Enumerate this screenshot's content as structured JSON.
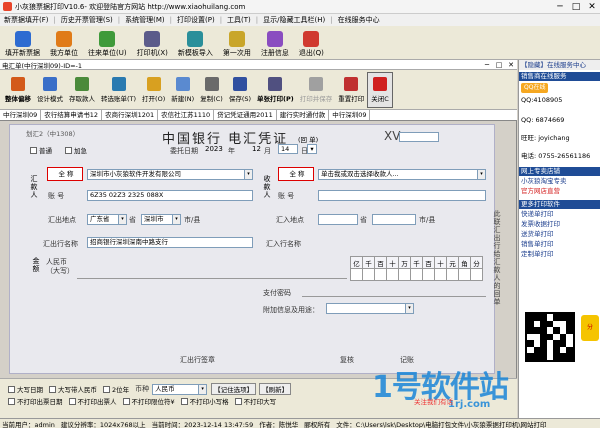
{
  "window": {
    "title": "小灰狼票据打印V10.6- 欢迎登陆官方网站 http://www.xiaohuilang.com"
  },
  "menu": [
    "新票据填开(F)",
    "历史开票管理(S)",
    "系统管理(M)",
    "打印设置(P)",
    "工具(T)",
    "显示/隐藏工具栏(H)",
    "在线服务中心"
  ],
  "toolbar": [
    {
      "label": "填开新票据",
      "icon": "new-bill-icon",
      "color": "#2d6bd1"
    },
    {
      "label": "我方单位",
      "icon": "my-company-icon",
      "color": "#e07b18"
    },
    {
      "label": "往来单位(U)",
      "icon": "partner-icon",
      "color": "#3f9a3a"
    },
    {
      "label": "打印机(X)",
      "icon": "printer-icon",
      "color": "#5b5b8a"
    },
    {
      "label": "新模板导入",
      "icon": "template-import-icon",
      "color": "#2a8f9a"
    },
    {
      "label": "第一次用",
      "icon": "first-use-icon",
      "color": "#c9a62a"
    },
    {
      "label": "注册信息",
      "icon": "register-icon",
      "color": "#8a4dc0"
    },
    {
      "label": "退出(Q)",
      "icon": "exit-icon",
      "color": "#d03a2f"
    }
  ],
  "document": {
    "title": "电汇单(中行深圳09)-ID=-1",
    "tools": [
      {
        "label": "整体偏移",
        "icon": "offset-icon",
        "color": "#d35a1a",
        "bold": true
      },
      {
        "label": "设计模式",
        "icon": "design-icon",
        "color": "#3a6fc8"
      },
      {
        "label": "存取款人",
        "icon": "save-person-icon",
        "color": "#4a8a3a"
      },
      {
        "label": "转选账单(T)",
        "icon": "select-bill-icon",
        "color": "#2a7ab0"
      },
      {
        "label": "打开(O)",
        "icon": "open-icon",
        "color": "#d8a020"
      },
      {
        "label": "新建(N)",
        "icon": "new-icon",
        "color": "#5a8ad0"
      },
      {
        "label": "复制(C)",
        "icon": "copy-icon",
        "color": "#6a6a6a"
      },
      {
        "label": "保存(S)",
        "icon": "save-icon",
        "color": "#3050a0"
      },
      {
        "label": "单张打印(P)",
        "icon": "print-single-icon",
        "color": "#505080",
        "bold": true
      },
      {
        "label": "打印并保存",
        "icon": "print-save-icon",
        "color": "#a0a0a0",
        "disabled": true
      },
      {
        "label": "重置打印",
        "icon": "reset-print-icon",
        "color": "#c03030"
      },
      {
        "label": "关闭C",
        "icon": "close-icon",
        "color": "#d02020",
        "outlined": true
      }
    ],
    "tabs": [
      "中行深圳09",
      "农行结算申请书12",
      "农商行深圳1201",
      "农信社江苏1110",
      "贷记凭证通用2011",
      "建行实时通付款",
      "中行深圳09"
    ]
  },
  "check": {
    "code": "划汇2（中1308）",
    "bank_title": "中国银行 电汇凭证",
    "bank_sub": "(回  单)",
    "serial": "XV",
    "opt_normal": "普通",
    "opt_urgent": "加急",
    "date_label": "委托日期",
    "year": "2023",
    "year_label": "年",
    "month": "12",
    "month_label": "月",
    "day": "14",
    "day_label": "日",
    "payer_label": "汇款人",
    "payee_label": "收款人",
    "name_label": "全  称",
    "account_label": "账    号",
    "remit_place_label": "汇出地点",
    "receive_place_label": "汇入地点",
    "payer_name": "深圳市小灰狼软件开发有限公司",
    "payee_name": "单击我或双击选择收款人...",
    "payer_account": "6Z35 02Z3 2325 088X",
    "province": "广东省",
    "province_label": "省",
    "city": "深圳市",
    "city_label": "市/县",
    "remit_bank_label": "汇出行名称",
    "remit_bank": "招商银行深圳深南中路支行",
    "receive_bank_label": "汇入行名称",
    "amount_label": "金额",
    "amount_sub": "人民币（大写）",
    "digits": [
      "亿",
      "千",
      "百",
      "十",
      "万",
      "千",
      "百",
      "十",
      "元",
      "角",
      "分"
    ],
    "pay_password": "支付密码",
    "attach_label": "附加信息及用途：",
    "remit_sign": "汇出行签章",
    "check_label": "复核",
    "book_label": "记账",
    "side_note": "此联汇出行给汇款人的回单"
  },
  "bottom": {
    "row1": [
      "大写日期",
      "大写带人民币",
      "2位年"
    ],
    "currency_label": "币种",
    "currency": "人民币",
    "record_btn": "【记住选项】",
    "refresh_btn": "【刷新】",
    "row2": [
      "不打印出票日期",
      "不打印出票人",
      "不打印限位符¥",
      "不打印小写格",
      "不打印大写"
    ]
  },
  "status": [
    "当前用户：admin",
    "建议分辨率：1024x768以上",
    "当前时间：2023-12-14 13:47:59",
    "作者：陈悦华",
    "郦权所有",
    "文件：C:\\Users\\lsk\\Desktop\\电脑打包文件\\小灰狼票据打印机\\网站打印"
  ],
  "side": {
    "top": "【隐藏】在线服务中心",
    "sales_hdr": "销售商在线服务",
    "qq1": "QQ:4108905",
    "qq2": "QQ: 6874669",
    "wangwang": "旺旺: joyichang",
    "phone": "电话:  0755-26561186",
    "shop_hdr": "网上专卖店铺",
    "shop1": "小灰狼淘宝专卖",
    "shop2": "官方网店直营",
    "more_hdr": "更多打印软件",
    "more": [
      "快递单打印",
      "发票收据打印",
      "送货单打印",
      "销售单打印",
      "定制单打印"
    ]
  },
  "watermark": {
    "brand": "1号软件站",
    "url": "1rj.com",
    "sub": "关注我们有话"
  }
}
